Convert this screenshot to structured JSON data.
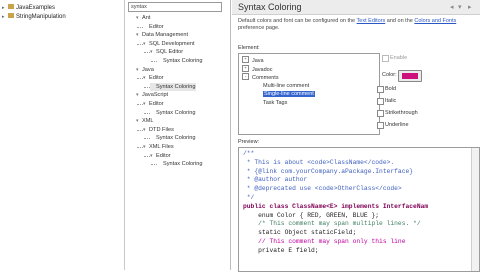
{
  "project_explorer": {
    "items": [
      {
        "label": "JavaExamples"
      },
      {
        "label": "StringManipulation"
      }
    ]
  },
  "filter": {
    "value": "syntax"
  },
  "tree": {
    "items": [
      {
        "label": "Ant",
        "level": 0
      },
      {
        "label": "Editor",
        "level": 1
      },
      {
        "label": "Data Management",
        "level": 0
      },
      {
        "label": "SQL Development",
        "level": 1
      },
      {
        "label": "SQL Editor",
        "level": 2
      },
      {
        "label": "Syntax Coloring",
        "level": 3
      },
      {
        "label": "Java",
        "level": 0
      },
      {
        "label": "Editor",
        "level": 1
      },
      {
        "label": "Syntax Coloring",
        "level": 2,
        "selected": true
      },
      {
        "label": "JavaScript",
        "level": 0
      },
      {
        "label": "Editor",
        "level": 1
      },
      {
        "label": "Syntax Coloring",
        "level": 2
      },
      {
        "label": "XML",
        "level": 0
      },
      {
        "label": "DTD Files",
        "level": 1
      },
      {
        "label": "Syntax Coloring",
        "level": 2
      },
      {
        "label": "XML Files",
        "level": 1
      },
      {
        "label": "Editor",
        "level": 2
      },
      {
        "label": "Syntax Coloring",
        "level": 3
      }
    ]
  },
  "page": {
    "title": "Syntax Coloring",
    "desc_pre": "Default colors and font can be configured on the ",
    "desc_link1": "Text Editors",
    "desc_mid": " and on the ",
    "desc_link2": "Colors and Fonts",
    "desc_post": " preference page.",
    "element_label": "Element:",
    "elements": [
      {
        "label": "Java",
        "expander": "+"
      },
      {
        "label": "Javadoc",
        "expander": "+"
      },
      {
        "label": "Comments",
        "expander": "-"
      },
      {
        "label": "Multi-line comment"
      },
      {
        "label": "Single-line comment",
        "selected": true
      },
      {
        "label": "Task Tags"
      }
    ],
    "enable_label": "Enable",
    "color_label": "Color:",
    "color_value": "#cc0f7a",
    "options": [
      {
        "label": "Bold"
      },
      {
        "label": "Italic"
      },
      {
        "label": "Strikethrough"
      },
      {
        "label": "Underline"
      }
    ],
    "preview_label": "Preview:"
  },
  "code_lines": [
    {
      "text": "/**",
      "cls": "c-doc"
    },
    {
      "text": " * This is about <code>ClassName</code>.",
      "cls": "c-doc"
    },
    {
      "text": " * {@link com.yourCompany.aPackage.Interface}",
      "cls": "c-doc"
    },
    {
      "text": " * @author author",
      "cls": "c-doc"
    },
    {
      "text": " * @deprecated use <code>OtherClass</code>",
      "cls": "c-doc"
    },
    {
      "text": " */",
      "cls": "c-doc"
    },
    {
      "text": "public class ClassName<E> implements InterfaceNam",
      "cls": "c-kw"
    },
    {
      "text": "    enum Color { RED, GREEN, BLUE };",
      "cls": "c-txt"
    },
    {
      "text": "    /* This comment may span multiple lines. */",
      "cls": "c-com"
    },
    {
      "text": "    static Object staticField;",
      "cls": "c-txt"
    },
    {
      "text": "    // This comment may span only this line",
      "cls": "c-single"
    },
    {
      "text": "    private E field;",
      "cls": "c-txt"
    }
  ]
}
